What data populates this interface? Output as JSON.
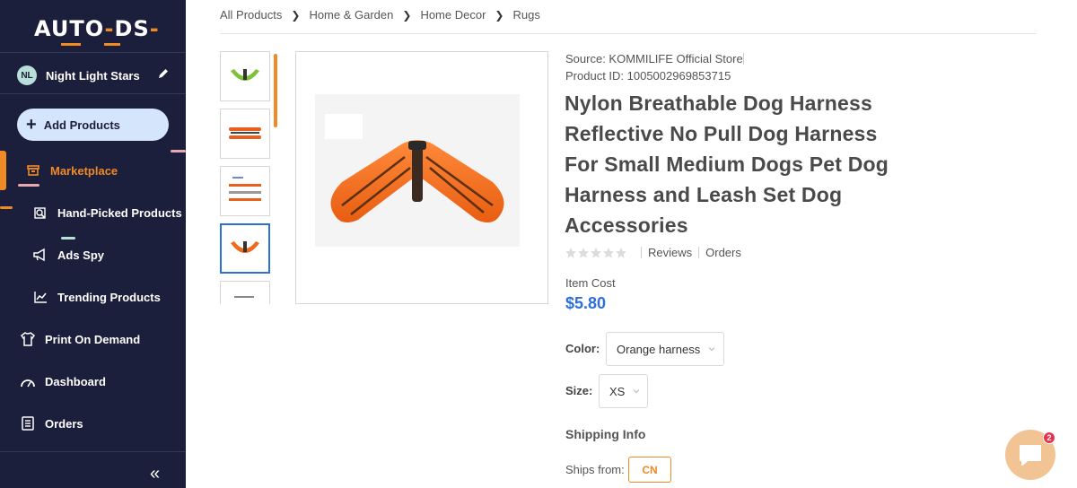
{
  "brand": {
    "logo_text_a": "AUTO",
    "logo_text_b": "DS",
    "accent": "#f08a24",
    "sidebar_bg": "#1b1f3b"
  },
  "store": {
    "initials": "NL",
    "name": "Night Light Stars"
  },
  "sidebar": {
    "add_products": "Add Products",
    "items": [
      {
        "label": "Marketplace",
        "icon": "store-icon",
        "active": true
      },
      {
        "label": "Hand-Picked Products",
        "icon": "hand-picked-icon"
      },
      {
        "label": "Ads Spy",
        "icon": "megaphone-icon"
      },
      {
        "label": "Trending Products",
        "icon": "trending-icon"
      },
      {
        "label": "Print On Demand",
        "icon": "shirt-icon"
      },
      {
        "label": "Dashboard",
        "icon": "gauge-icon"
      },
      {
        "label": "Orders",
        "icon": "orders-icon"
      }
    ],
    "collapse": "«"
  },
  "breadcrumb": [
    "All Products",
    "Home & Garden",
    "Home Decor",
    "Rugs"
  ],
  "product": {
    "source": "Source: KOMMILIFE Official Store",
    "product_id": "Product ID: 1005002969853715",
    "title": "Nylon Breathable Dog Harness Reflective No Pull Dog Harness For Small Medium Dogs Pet Dog Harness and Leash Set Dog Accessories",
    "reviews": "Reviews",
    "orders": "Orders",
    "item_cost_label": "Item Cost",
    "price": "$5.80",
    "color_label": "Color:",
    "color_value": "Orange harness",
    "size_label": "Size:",
    "size_value": "XS",
    "shipping_heading": "Shipping Info",
    "ships_from_label": "Ships from:",
    "ships_from_value": "CN"
  },
  "chat": {
    "badge": "2"
  }
}
